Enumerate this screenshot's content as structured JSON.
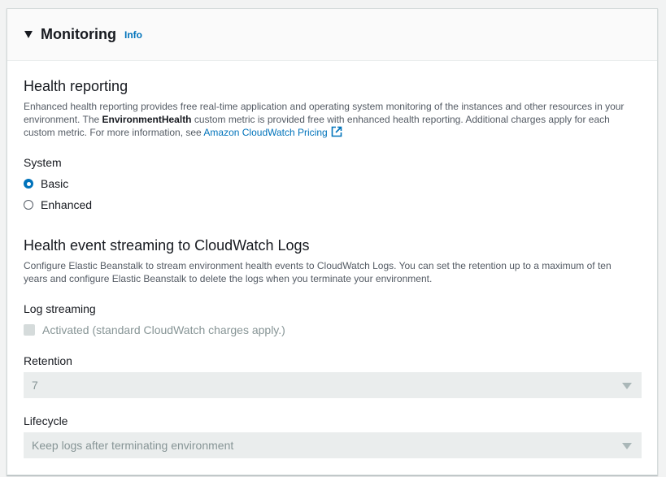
{
  "header": {
    "title": "Monitoring",
    "info_label": "Info"
  },
  "health_reporting": {
    "title": "Health reporting",
    "desc_part1": "Enhanced health reporting provides free real-time application and operating system monitoring of the instances and other resources in your environment. The ",
    "desc_bold": "EnvironmentHealth",
    "desc_part2": " custom metric is provided free with enhanced health reporting. Additional charges apply for each custom metric. For more information, see ",
    "link_label": "Amazon CloudWatch Pricing",
    "system_label": "System",
    "options": [
      {
        "label": "Basic",
        "selected": true
      },
      {
        "label": "Enhanced",
        "selected": false
      }
    ]
  },
  "streaming": {
    "title": "Health event streaming to CloudWatch Logs",
    "desc": "Configure Elastic Beanstalk to stream environment health events to CloudWatch Logs. You can set the retention up to a maximum of ten years and configure Elastic Beanstalk to delete the logs when you terminate your environment.",
    "log_streaming_label": "Log streaming",
    "checkbox_label": "Activated (standard CloudWatch charges apply.)",
    "checkbox_checked": false,
    "retention_label": "Retention",
    "retention_value": "7",
    "lifecycle_label": "Lifecycle",
    "lifecycle_value": "Keep logs after terminating environment"
  },
  "colors": {
    "accent": "#0073bb",
    "disabled_bg": "#eaeded",
    "disabled_text": "#879596"
  }
}
